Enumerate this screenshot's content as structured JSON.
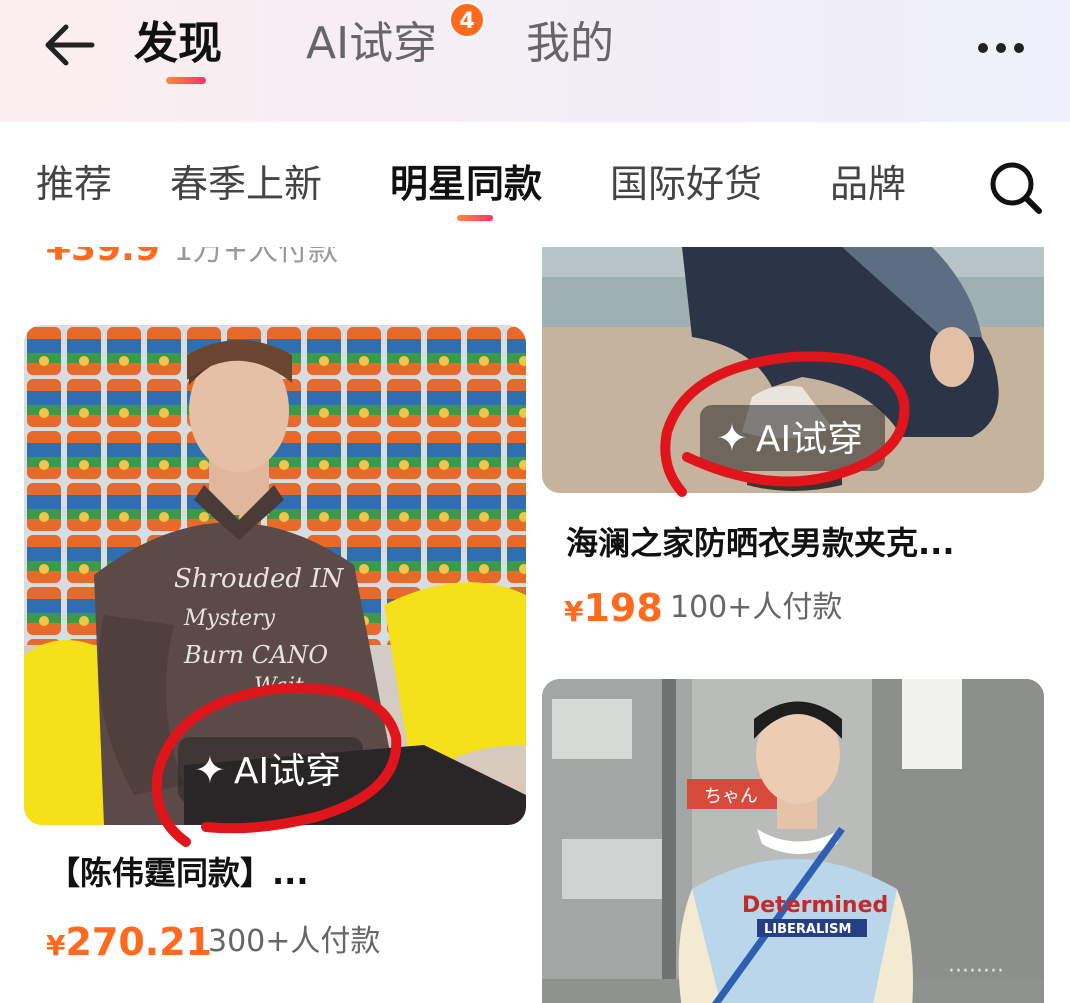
{
  "header": {
    "tabs": [
      {
        "label": "发现",
        "active": true
      },
      {
        "label": "AI试穿",
        "active": false,
        "badge": "4"
      },
      {
        "label": "我的",
        "active": false
      }
    ],
    "back_icon": "arrow-left-icon",
    "more_icon": "more-dots-icon"
  },
  "categories": {
    "items": [
      "推荐",
      "春季上新",
      "明星同款",
      "国际好货",
      "品牌"
    ],
    "active": "明星同款",
    "search_icon": "search-icon"
  },
  "feed": {
    "cut_off_item": {
      "price": "¥39.9",
      "sales": "1万+人付款"
    },
    "products": [
      {
        "title": "【陈伟霆同款】...",
        "price_symbol": "¥",
        "price": "270.21",
        "sales": "300+人付款",
        "tryon_label": "AI试穿"
      },
      {
        "title": "海澜之家防晒衣男款夹克...",
        "price_symbol": "¥",
        "price": "198",
        "sales": "100+人付款",
        "tryon_label": "AI试穿"
      },
      {
        "title": "",
        "price": "",
        "sales": ""
      }
    ],
    "shirt_print": "Shrouded IN Mystery Burn CANO Wait",
    "sweater_print": "Determined LIBERALISM",
    "sign_text": "ちゃん"
  },
  "colors": {
    "accent": "#ff6a1f",
    "underline_start": "#ff8a3d",
    "underline_end": "#ff2f6b",
    "annotation_red": "#e0141b",
    "header_bg": "#f6eef4"
  }
}
